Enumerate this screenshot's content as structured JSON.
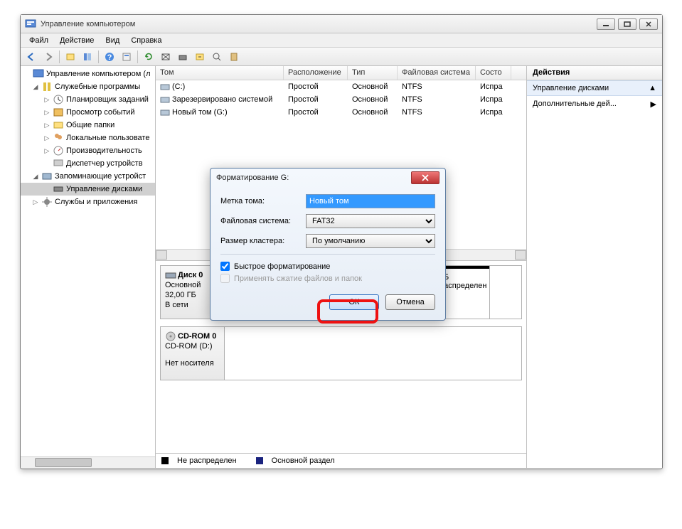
{
  "window": {
    "title": "Управление компьютером"
  },
  "menu": {
    "file": "Файл",
    "action": "Действие",
    "view": "Вид",
    "help": "Справка"
  },
  "tree": {
    "root": "Управление компьютером (л",
    "sys_tools": "Служебные программы",
    "scheduler": "Планировщик заданий",
    "events": "Просмотр событий",
    "shared": "Общие папки",
    "users": "Локальные пользовате",
    "perf": "Производительность",
    "devmgr": "Диспетчер устройств",
    "storage": "Запоминающие устройст",
    "diskmgmt": "Управление дисками",
    "services": "Службы и приложения"
  },
  "list": {
    "headers": {
      "vol": "Том",
      "layout": "Расположение",
      "type": "Тип",
      "fs": "Файловая система",
      "status": "Состо"
    },
    "rows": [
      {
        "vol": "(C:)",
        "layout": "Простой",
        "type": "Основной",
        "fs": "NTFS",
        "status": "Испра"
      },
      {
        "vol": "Зарезервировано системой",
        "layout": "Простой",
        "type": "Основной",
        "fs": "NTFS",
        "status": "Испра"
      },
      {
        "vol": "Новый том (G:)",
        "layout": "Простой",
        "type": "Основной",
        "fs": "NTFS",
        "status": "Испра"
      }
    ]
  },
  "disk0": {
    "name": "Диск 0",
    "type": "Основной",
    "size": "32,00 ГБ",
    "state": "В сети",
    "unalloc_size": "ГБ",
    "unalloc_label": "распределен"
  },
  "cdrom": {
    "name": "CD-ROM 0",
    "drive": "CD-ROM (D:)",
    "state": "Нет носителя"
  },
  "legend": {
    "unalloc": "Не распределен",
    "primary": "Основной раздел"
  },
  "actions": {
    "header": "Действия",
    "diskmgmt": "Управление дисками",
    "more": "Дополнительные дей..."
  },
  "dialog": {
    "title": "Форматирование G:",
    "label_volume": "Метка тома:",
    "value_volume": "Новый том",
    "label_fs": "Файловая система:",
    "value_fs": "FAT32",
    "label_cluster": "Размер кластера:",
    "value_cluster": "По умолчанию",
    "chk_quick": "Быстрое форматирование",
    "chk_compress": "Применять сжатие файлов и папок",
    "ok": "ОК",
    "cancel": "Отмена"
  },
  "colors": {
    "unalloc": "#000000",
    "primary": "#1a237e"
  }
}
